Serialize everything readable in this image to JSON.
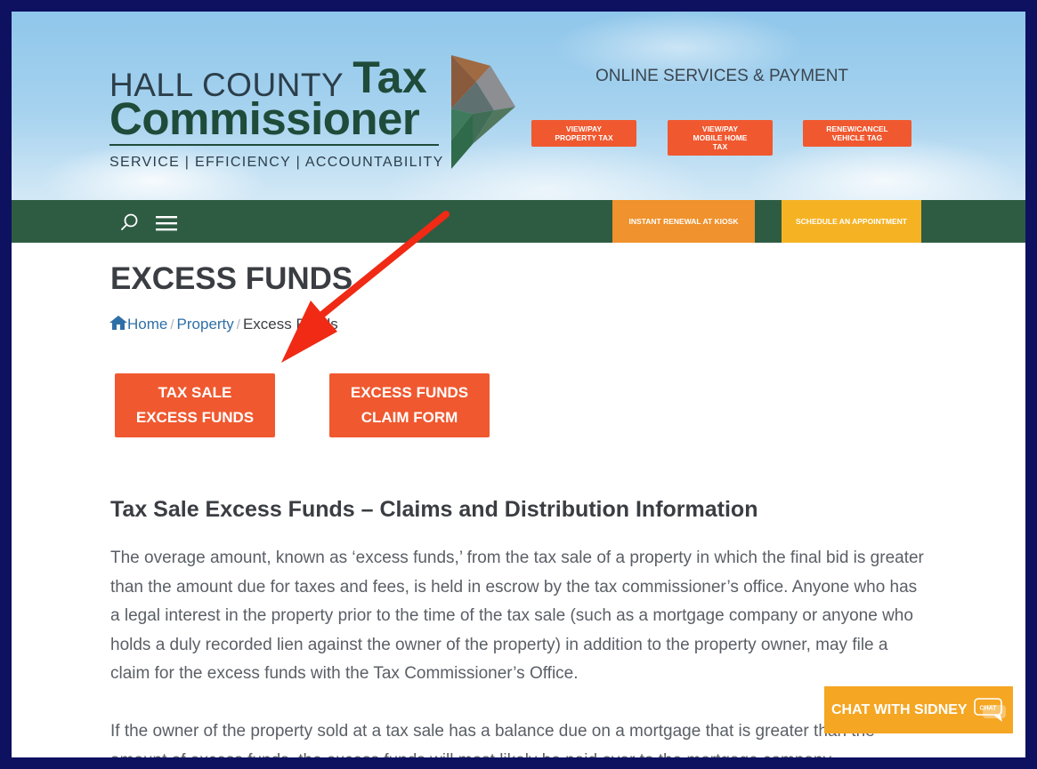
{
  "logo": {
    "line1": "HALL COUNTY",
    "line1_tax": "Tax",
    "line2": "Commissioner",
    "tagline": "SERVICE | EFFICIENCY | ACCOUNTABILITY"
  },
  "header": {
    "online_title": "ONLINE SERVICES & PAYMENT",
    "services": [
      {
        "line1": "VIEW/PAY",
        "line2": "PROPERTY TAX",
        "line3": ""
      },
      {
        "line1": "VIEW/PAY",
        "line2": "MOBILE HOME",
        "line3": "TAX"
      },
      {
        "line1": "RENEW/CANCEL",
        "line2": "VEHICLE TAG",
        "line3": ""
      }
    ]
  },
  "nav": {
    "kiosk_label": "INSTANT RENEWAL AT KIOSK",
    "appointment_label": "SCHEDULE AN APPOINTMENT",
    "kiosk_color": "#f0922d",
    "appointment_color": "#f5b324"
  },
  "page": {
    "title": "EXCESS FUNDS",
    "breadcrumb": {
      "home": "Home",
      "sep": "/",
      "property": "Property",
      "current": "Excess Funds"
    },
    "buttons": [
      {
        "line1": "TAX SALE",
        "line2": "EXCESS FUNDS"
      },
      {
        "line1": "EXCESS FUNDS",
        "line2": "CLAIM FORM"
      }
    ],
    "section_heading": "Tax Sale Excess Funds – Claims and Distribution Information",
    "paragraph1": "The overage amount, known as ‘excess funds,’ from the tax sale of a property in which the final bid is greater than the amount due for taxes and fees, is held in escrow by the tax commissioner’s office. Anyone who has a legal interest in the property prior to the time of the tax sale (such as a mortgage company or anyone who holds a duly recorded lien against the owner of the property) in addition to the property owner, may file a claim for the excess funds with the Tax Commissioner’s Office.",
    "paragraph2": "If the owner of the property sold at a tax sale has a balance due on a mortgage that is greater than the amount of excess funds, the excess funds will most likely be paid over to the mortgage company."
  },
  "chat": {
    "label": "CHAT WITH SIDNEY",
    "icon_text": "CHAT"
  },
  "colors": {
    "brand_orange": "#f0582f",
    "nav_green": "#2e5c43",
    "brand_dark_green": "#1f4b3a",
    "chat_yellow": "#f5a623",
    "annotation_arrow": "#f02a14"
  }
}
